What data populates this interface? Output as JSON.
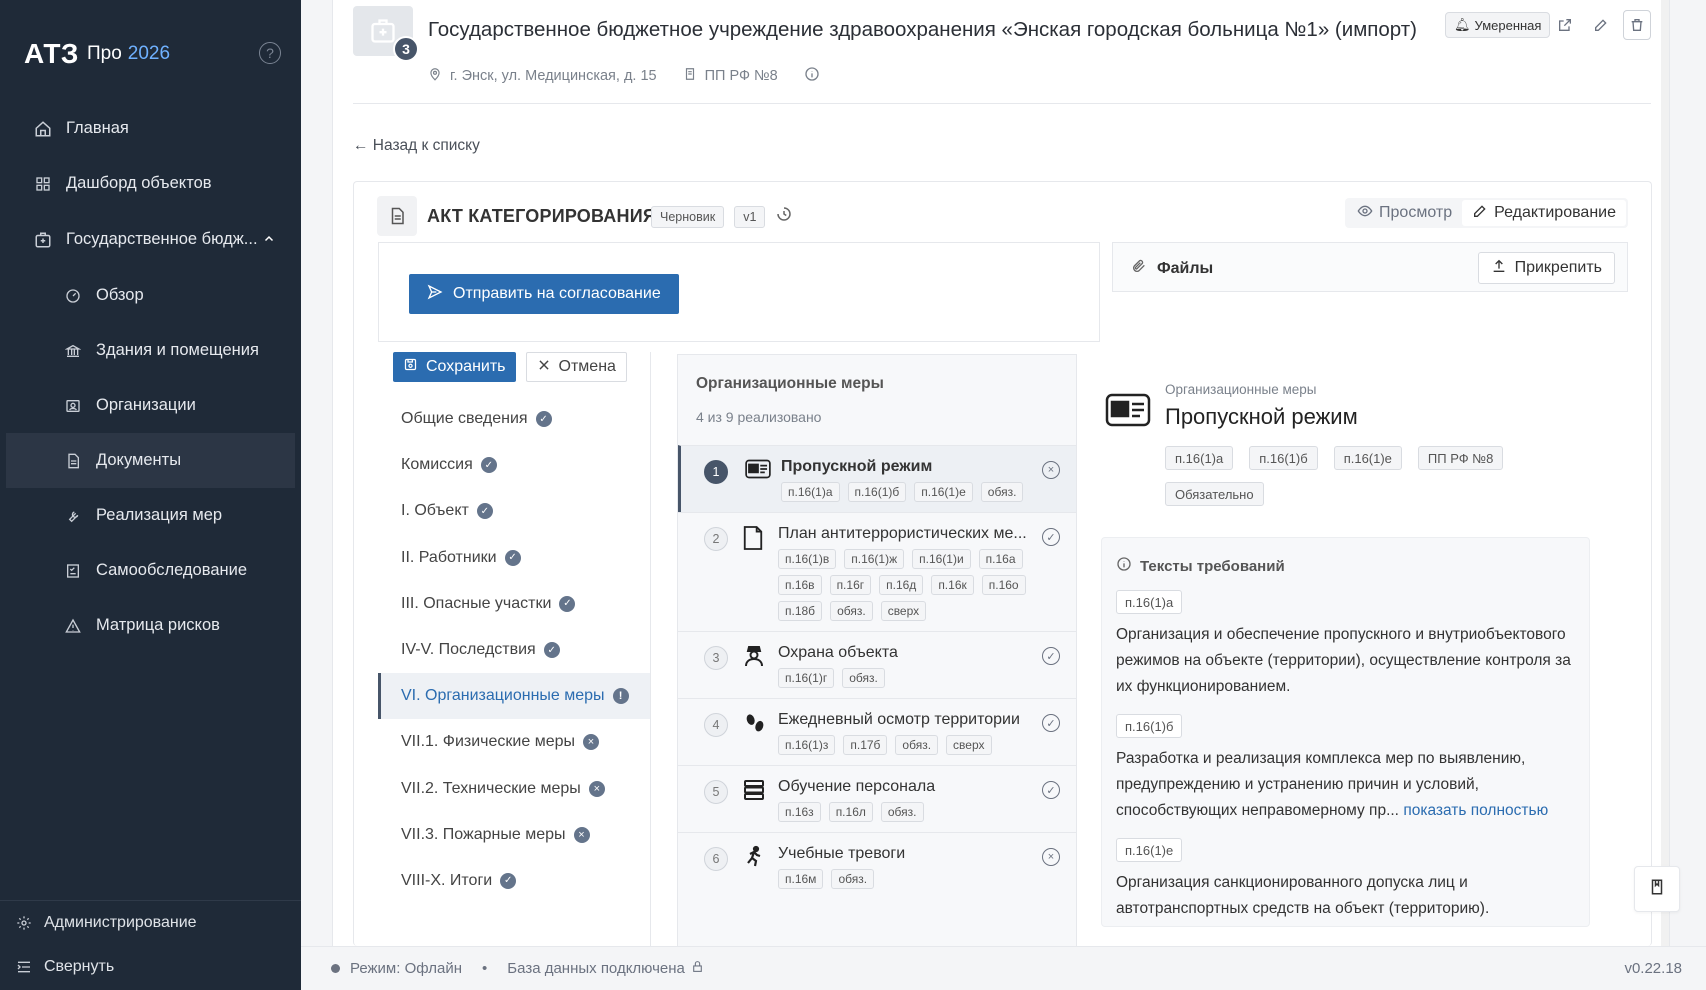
{
  "app": {
    "logo": "АТЗ",
    "product": "Про",
    "year": "2026"
  },
  "sidebar": {
    "items": [
      {
        "label": "Главная",
        "icon": "home-icon"
      },
      {
        "label": "Дашборд объектов",
        "icon": "grid-icon"
      },
      {
        "label": "Государственное бюдж...",
        "icon": "building-icon",
        "expanded": true
      },
      {
        "label": "Обзор",
        "icon": "gauge-icon"
      },
      {
        "label": "Здания и помещения",
        "icon": "bank-icon"
      },
      {
        "label": "Организации",
        "icon": "id-card-icon"
      },
      {
        "label": "Документы",
        "icon": "document-icon",
        "active": true
      },
      {
        "label": "Реализация мер",
        "icon": "wrench-icon"
      },
      {
        "label": "Самообследование",
        "icon": "checklist-icon"
      },
      {
        "label": "Матрица рисков",
        "icon": "warning-icon"
      }
    ],
    "footer": {
      "admin": "Администрирование",
      "collapse": "Свернуть"
    }
  },
  "object": {
    "title": "Государственное бюджетное учреждение здравоохранения «Энская городская больница №1» (импорт)",
    "count": "3",
    "risk": "Умеренная",
    "address": "г. Энск, ул. Медицинская, д. 15",
    "regulation": "ПП РФ №8"
  },
  "back": "← Назад к списку",
  "act": {
    "title": "АКТ КАТЕГОРИРОВАНИЯ",
    "status": "Черновик",
    "version": "v1",
    "view": "Просмотр",
    "edit": "Редактирование",
    "submit": "Отправить на согласование",
    "files": "Файлы",
    "attach": "Прикрепить",
    "save": "Сохранить",
    "cancel": "Отмена"
  },
  "sections": [
    {
      "label": "Общие сведения",
      "state": "done"
    },
    {
      "label": "Комиссия",
      "state": "done"
    },
    {
      "label": "I. Объект",
      "state": "done"
    },
    {
      "label": "II. Работники",
      "state": "done"
    },
    {
      "label": "III. Опасные участки",
      "state": "done"
    },
    {
      "label": "IV-V. Последствия",
      "state": "done"
    },
    {
      "label": "VI. Организационные меры",
      "state": "info",
      "active": true
    },
    {
      "label": "VII.1. Физические меры",
      "state": "todo"
    },
    {
      "label": "VII.2. Технические меры",
      "state": "todo"
    },
    {
      "label": "VII.3. Пожарные меры",
      "state": "todo"
    },
    {
      "label": "VIII-X. Итоги",
      "state": "done"
    }
  ],
  "measures": {
    "title": "Организационные меры",
    "progress": "4 из 9 реализовано",
    "items": [
      {
        "num": "1",
        "name": "Пропускной режим",
        "icon": "pass-card-icon",
        "tags": [
          "п.16(1)а",
          "п.16(1)б",
          "п.16(1)е",
          "обяз."
        ],
        "status": "rejected",
        "active": true
      },
      {
        "num": "2",
        "name": "План антитеррористических ме...",
        "icon": "page-icon",
        "tags": [
          "п.16(1)в",
          "п.16(1)ж",
          "п.16(1)и",
          "п.16а",
          "п.16в",
          "п.16г",
          "п.16д",
          "п.16к",
          "п.16о",
          "п.18б",
          "обяз.",
          "сверх"
        ],
        "status": "done"
      },
      {
        "num": "3",
        "name": "Охрана объекта",
        "icon": "guard-icon",
        "tags": [
          "п.16(1)г",
          "обяз."
        ],
        "status": "done"
      },
      {
        "num": "4",
        "name": "Ежедневный осмотр территории",
        "icon": "footprints-icon",
        "tags": [
          "п.16(1)з",
          "п.17б",
          "обяз.",
          "сверх"
        ],
        "status": "done"
      },
      {
        "num": "5",
        "name": "Обучение персонала",
        "icon": "books-icon",
        "tags": [
          "п.16з",
          "п.16л",
          "обяз."
        ],
        "status": "done"
      },
      {
        "num": "6",
        "name": "Учебные тревоги",
        "icon": "running-icon",
        "tags": [
          "п.16м",
          "обяз."
        ],
        "status": "rejected"
      }
    ]
  },
  "detail": {
    "category": "Организационные меры",
    "title": "Пропускной режим",
    "tags": [
      "п.16(1)а",
      "п.16(1)б",
      "п.16(1)е",
      "ПП РФ №8",
      "Обязательно"
    ],
    "req_title": "Тексты требований",
    "requirements": [
      {
        "ref": "п.16(1)а",
        "text": "Организация и обеспечение пропускного и внутриобъектового режимов на объекте (территории), осуществление контроля за их функционированием."
      },
      {
        "ref": "п.16(1)б",
        "text": "Разработка и реализация комплекса мер по выявлению, предупреждению и устранению причин и условий, способствующих неправомерному пр...",
        "more": "показать полностью"
      },
      {
        "ref": "п.16(1)е",
        "text": "Организация санкционированного допуска лиц и автотранспортных средств на объект (территорию)."
      }
    ]
  },
  "status": {
    "mode": "Режим: Офлайн",
    "db": "База данных подключена",
    "version": "v0.22.18"
  }
}
